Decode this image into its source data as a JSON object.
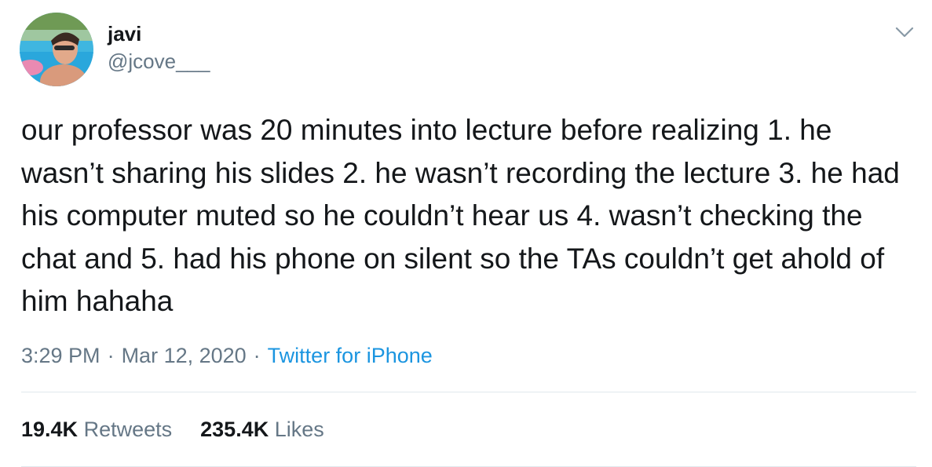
{
  "author": {
    "display_name": "javi",
    "handle": "@jcove___"
  },
  "tweet": {
    "text": "our professor was 20 minutes into lecture before realizing 1. he wasn’t sharing his slides 2. he wasn’t recording the lecture 3. he had his computer muted so he couldn’t hear us 4. wasn’t checking the chat and 5. had his phone on silent so the TAs couldn’t get ahold of him hahaha",
    "time": "3:29 PM",
    "separator": "·",
    "date": "Mar 12, 2020",
    "source": "Twitter for iPhone"
  },
  "stats": {
    "retweets_count": "19.4K",
    "retweets_label": "Retweets",
    "likes_count": "235.4K",
    "likes_label": "Likes"
  },
  "colors": {
    "text": "#14171a",
    "secondary": "#657786",
    "link": "#1b95e0",
    "divider": "#e1e8ed"
  },
  "icons": {
    "menu": "chevron-down-icon",
    "avatar": "profile-photo"
  }
}
